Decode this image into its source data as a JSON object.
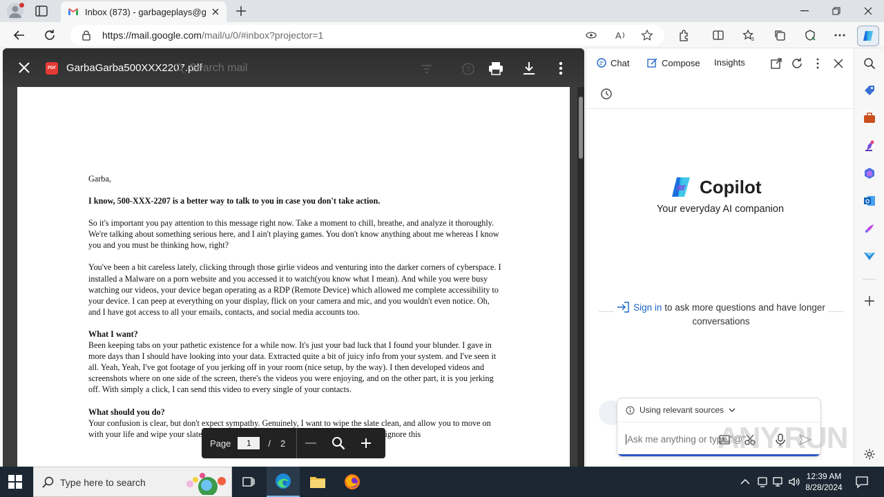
{
  "browser": {
    "tab_title": "Inbox (873) - garbageplays@gma",
    "url_host": "https://mail.google.com",
    "url_path": "/mail/u/0/#inbox?projector=1"
  },
  "viewer": {
    "filename": "GarbaGarba500XXX2207.pdf",
    "ghost_search_placeholder": "Search mail",
    "pdf_badge": "PDF"
  },
  "letter": {
    "greeting": "Garba,",
    "headline": "I know, 500-XXX-2207 is a better way to talk to you in case you don't take action.",
    "para1": "So it's important you pay attention to this message right now. Take a moment to chill, breathe, and analyze it thoroughly. We're talking about something serious here, and I ain't playing games. You don't know anything about me whereas I know you and you must be thinking how, right?",
    "para2": "You've been a bit careless lately, clicking through those girlie videos and venturing into the darker corners of cyberspace. I installed a Malware on a porn website and you accessed it to watch(you know what I mean). And while you were busy watching our videos, your device began operating as a RDP (Remote Device) which allowed me complete accessibility to your device. I can peep at everything on your display, flick on your camera and mic, and you wouldn't even notice. Oh, and I have got access to all your emails, contacts, and social media accounts too.",
    "heading_want": "What I want?",
    "para3": "Been keeping tabs on your pathetic existence for a while now. It's just your bad luck that I found your blunder. I gave in more days than I should have looking into your data. Extracted quite a bit of juicy info from your system. and I've seen it all. Yeah, Yeah, I've got footage of you jerking off in your room (nice setup, by the way). I then developed videos and screenshots where on one side of the screen, there's the videos you were enjoying, and on the other part, it is you jerking off. With simply a click, I can send this video to every single of your contacts.",
    "heading_should": "What should you do?",
    "para4": "Your confusion is clear, but don't expect sympathy. Genuinely, I want to wipe the slate clean, and allow you to move on with your life and wipe your slate clean. I am going to give you two alternatives. Either ignore this"
  },
  "pagebar": {
    "page_label": "Page",
    "current_page": "1",
    "slash": "/",
    "total_pages": "2"
  },
  "copilot": {
    "tab_chat": "Chat",
    "tab_compose": "Compose",
    "tab_insights": "Insights",
    "title": "Copilot",
    "subtitle": "Your everyday AI companion",
    "signin_link": "Sign in",
    "signin_rest": " to ask more questions and have longer conversations",
    "sources_label": "Using relevant sources",
    "input_placeholder": "Ask me anything or type \"@\"",
    "watermark": "ANY.RUN"
  },
  "taskbar": {
    "search_placeholder": "Type here to search",
    "time": "12:39 AM",
    "date": "8/28/2024"
  },
  "colors": {
    "accent": "#1b62c7",
    "viewer_bg": "#3c3c3c",
    "taskbar_bg": "#1c2733"
  }
}
